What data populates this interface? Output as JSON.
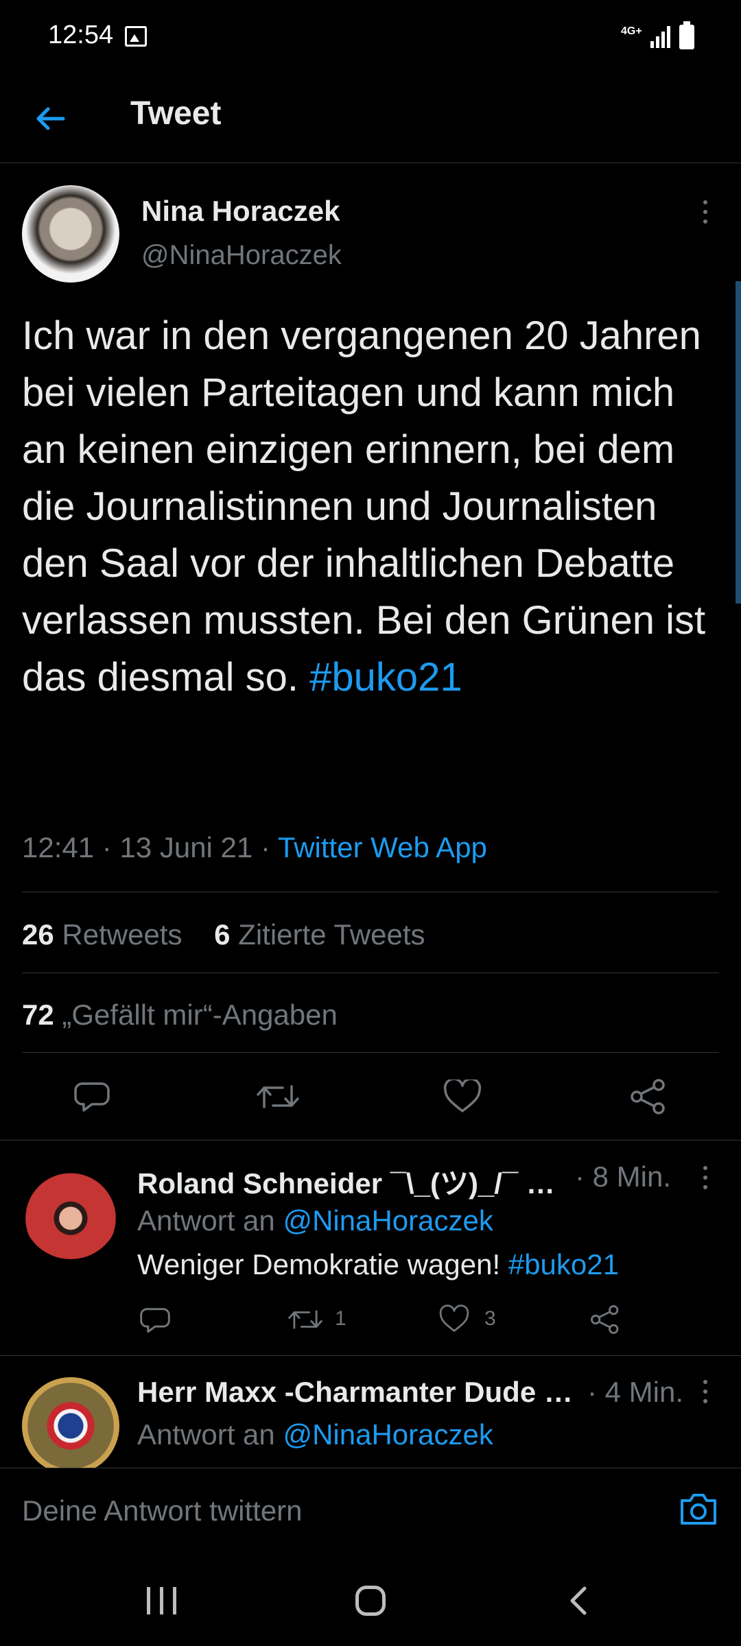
{
  "status_bar": {
    "time": "12:54",
    "network": "4G+"
  },
  "header": {
    "title": "Tweet"
  },
  "tweet": {
    "author_name": "Nina Horaczek",
    "author_handle": "@NinaHoraczek",
    "text": "Ich war in den vergangenen 20 Jahren bei vielen Parteitagen und kann mich an keinen einzigen erinnern, bei dem die Journalistinnen und Journalisten den Saal vor der inhaltlichen Debatte verlassen mussten. Bei den Grünen ist das diesmal so.",
    "hashtag": "#buko21",
    "time": "12:41",
    "date": "13 Juni 21",
    "source": "Twitter Web App",
    "retweet_count": "26",
    "retweet_label": "Retweets",
    "quote_count": "6",
    "quote_label": "Zitierte Tweets",
    "like_count": "72",
    "like_label": "„Gefällt mir“-Angaben"
  },
  "replies": [
    {
      "name": "Roland Schneider ¯\\_(ツ)_/¯ …",
      "time": "· 8 Min.",
      "reply_prefix": "Antwort an",
      "reply_to": "@NinaHoraczek",
      "text": "Weniger Demokratie wagen!",
      "hashtag": "#buko21",
      "retweets": "1",
      "likes": "3"
    },
    {
      "name": "Herr Maxx -Charmanter Dude …",
      "time": "· 4 Min.",
      "reply_prefix": "Antwort an",
      "reply_to": "@NinaHoraczek"
    }
  ],
  "compose": {
    "placeholder": "Deine Antwort twittern"
  },
  "colors": {
    "background": "#000000",
    "accent": "#1d9bf0",
    "secondary_text": "#71767b",
    "divider": "#2f3336"
  },
  "icons": [
    "back-arrow-icon",
    "more-vertical-icon",
    "reply-icon",
    "retweet-icon",
    "like-icon",
    "share-icon",
    "camera-icon"
  ]
}
